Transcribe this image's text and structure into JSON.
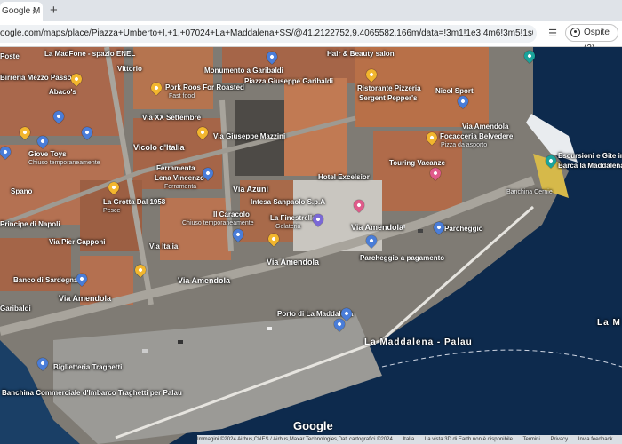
{
  "browser": {
    "tab_title": "Google M",
    "tab_close": "×",
    "new_tab": "+",
    "url": "oogle.com/maps/place/Piazza+Umberto+I,+1,+07024+La+Maddalena+SS/@41.2122752,9.4065582,166m/data=!3m1!1e3!4m6!3m5!1s0x12d94281b055399:0x6f...",
    "ext_icon": "playlist-icon",
    "guest_label": "Ospite (2)"
  },
  "map": {
    "colors": {
      "sea": "#0d2a4d",
      "roof": "#b76a4a",
      "pavement": "#8d8a84",
      "pin_yellow": "#f2b62e",
      "pin_blue": "#4a7dd8"
    },
    "labels": [
      {
        "id": "poste",
        "text": "Poste"
      },
      {
        "id": "madfone",
        "text": "La MadFone - spazio ENEL"
      },
      {
        "id": "birreria",
        "text": "Birreria Mezzo Passo"
      },
      {
        "id": "abaco",
        "text": "Abaco's"
      },
      {
        "id": "giove",
        "text": "Giove Toys"
      },
      {
        "id": "giove_sub",
        "text": "Chiuso temporaneamente"
      },
      {
        "id": "spano",
        "text": "Spano"
      },
      {
        "id": "vittorio",
        "text": "Vittorio"
      },
      {
        "id": "monumento",
        "text": "Monumento a Garibaldi"
      },
      {
        "id": "pork",
        "text": "Pork Roos For Roasted"
      },
      {
        "id": "pork_sub",
        "text": "Fast food"
      },
      {
        "id": "piazza",
        "text": "Piazza Giuseppe Garibaldi"
      },
      {
        "id": "xxsett",
        "text": "Via XX Settembre"
      },
      {
        "id": "vicolo",
        "text": "Vicolo d'Italia"
      },
      {
        "id": "ferramenta",
        "text": "Ferramenta"
      },
      {
        "id": "ferramenta2",
        "text": "Lena Vincenzo"
      },
      {
        "id": "ferramenta_sub",
        "text": "Ferramenta"
      },
      {
        "id": "viamazzini",
        "text": "Via Giuseppe Mazzini"
      },
      {
        "id": "hair",
        "text": "Hair & Beauty salon"
      },
      {
        "id": "ristorante",
        "text": "Ristorante Pizzeria"
      },
      {
        "id": "ristorante2",
        "text": "Sergent Pepper's"
      },
      {
        "id": "nicol",
        "text": "Nicol Sport"
      },
      {
        "id": "focacceria",
        "text": "Focacceria Belvedere"
      },
      {
        "id": "focacceria_sub",
        "text": "Pizza da asporto"
      },
      {
        "id": "touring",
        "text": "Touring Vacanze"
      },
      {
        "id": "escursioni",
        "text": "Escursioni e Gite in"
      },
      {
        "id": "escursioni2",
        "text": "Barca la Maddalena"
      },
      {
        "id": "banchina_comm",
        "text": "Banchina Cernie"
      },
      {
        "id": "via_amendola_r",
        "text": "Via Amendola"
      },
      {
        "id": "hotel",
        "text": "Hotel Excelsior"
      },
      {
        "id": "intesa",
        "text": "Intesa Sanpaolo S.p.A"
      },
      {
        "id": "finestrella",
        "text": "La Finestrella"
      },
      {
        "id": "finestrella_sub",
        "text": "Gelateria"
      },
      {
        "id": "caracolo",
        "text": "Il Caracolo"
      },
      {
        "id": "caracolo_sub",
        "text": "Chiuso temporaneamente"
      },
      {
        "id": "grotta",
        "text": "La Grotta Dal 1958"
      },
      {
        "id": "grotta_sub",
        "text": "Pesce"
      },
      {
        "id": "via_azuni",
        "text": "Via Azuni"
      },
      {
        "id": "via_italia",
        "text": "Via Italia"
      },
      {
        "id": "via_amendola_c",
        "text": "Via Amendola"
      },
      {
        "id": "via_amendola_m",
        "text": "Via Amendola"
      },
      {
        "id": "via_amendola_l",
        "text": "Via Amendola"
      },
      {
        "id": "via_amendola_far",
        "text": "Via Amendola"
      },
      {
        "id": "parcheggio",
        "text": "Parcheggio"
      },
      {
        "id": "parcheggio_pag",
        "text": "Parcheggio a pagamento"
      },
      {
        "id": "principe",
        "text": "Principe di Napoli"
      },
      {
        "id": "via_capponi",
        "text": "Via Pier Capponi"
      },
      {
        "id": "banco",
        "text": "Banco di Sardegna"
      },
      {
        "id": "garibaldi",
        "text": "Garibaldi"
      },
      {
        "id": "porto",
        "text": "Porto di La Maddalena"
      },
      {
        "id": "maddalena_palau",
        "text": "La Maddalena - Palau"
      },
      {
        "id": "la_mad_r",
        "text": "La M"
      },
      {
        "id": "biglietteria",
        "text": "Biglietteria Traghetti"
      },
      {
        "id": "banchina",
        "text": "Banchina Commerciale d'Imbarco Traghetti per Palau"
      }
    ],
    "google_logo": "Google",
    "footer": {
      "imagery": "Immagini ©2024 Airbus,CNES / Airbus,Maxar Technologies,Dati cartografici ©2024",
      "lang": "Italia",
      "earth": "La vista 3D di Earth non è disponibile",
      "terms": "Termini",
      "privacy": "Privacy",
      "feedback": "Invia feedback"
    }
  }
}
